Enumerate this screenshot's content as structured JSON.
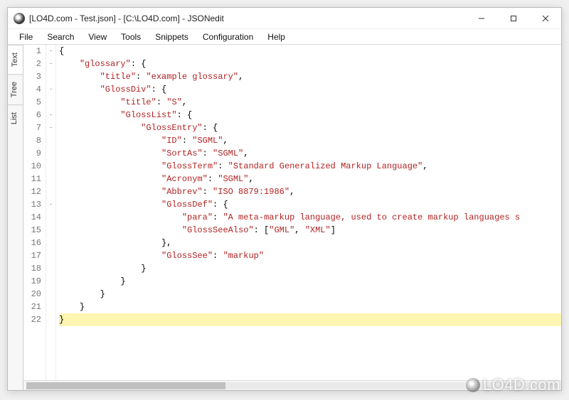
{
  "window": {
    "title": "[LO4D.com - Test.json] - [C:\\LO4D.com] - JSONedit"
  },
  "menu": {
    "file": "File",
    "search": "Search",
    "view": "View",
    "tools": "Tools",
    "snippets": "Snippets",
    "configuration": "Configuration",
    "help": "Help"
  },
  "side_tabs": {
    "text": "Text",
    "tree": "Tree",
    "list": "List"
  },
  "editor": {
    "line_count": 22,
    "fold_markers": {
      "1": "-",
      "2": "-",
      "4": "-",
      "6": "-",
      "7": "-",
      "13": "-"
    },
    "current_line": 22,
    "lines": [
      {
        "n": 1,
        "indent": 0,
        "tokens": [
          {
            "t": "{",
            "c": "p"
          }
        ]
      },
      {
        "n": 2,
        "indent": 4,
        "tokens": [
          {
            "t": "\"glossary\"",
            "c": "k"
          },
          {
            "t": ": {",
            "c": "p"
          }
        ]
      },
      {
        "n": 3,
        "indent": 8,
        "tokens": [
          {
            "t": "\"title\"",
            "c": "k"
          },
          {
            "t": ": ",
            "c": "p"
          },
          {
            "t": "\"example glossary\"",
            "c": "s"
          },
          {
            "t": ",",
            "c": "p"
          }
        ]
      },
      {
        "n": 4,
        "indent": 8,
        "tokens": [
          {
            "t": "\"GlossDiv\"",
            "c": "k"
          },
          {
            "t": ": {",
            "c": "p"
          }
        ]
      },
      {
        "n": 5,
        "indent": 12,
        "tokens": [
          {
            "t": "\"title\"",
            "c": "k"
          },
          {
            "t": ": ",
            "c": "p"
          },
          {
            "t": "\"S\"",
            "c": "s"
          },
          {
            "t": ",",
            "c": "p"
          }
        ]
      },
      {
        "n": 6,
        "indent": 12,
        "tokens": [
          {
            "t": "\"GlossList\"",
            "c": "k"
          },
          {
            "t": ": {",
            "c": "p"
          }
        ]
      },
      {
        "n": 7,
        "indent": 16,
        "tokens": [
          {
            "t": "\"GlossEntry\"",
            "c": "k"
          },
          {
            "t": ": {",
            "c": "p"
          }
        ]
      },
      {
        "n": 8,
        "indent": 20,
        "tokens": [
          {
            "t": "\"ID\"",
            "c": "k"
          },
          {
            "t": ": ",
            "c": "p"
          },
          {
            "t": "\"SGML\"",
            "c": "s"
          },
          {
            "t": ",",
            "c": "p"
          }
        ]
      },
      {
        "n": 9,
        "indent": 20,
        "tokens": [
          {
            "t": "\"SortAs\"",
            "c": "k"
          },
          {
            "t": ": ",
            "c": "p"
          },
          {
            "t": "\"SGML\"",
            "c": "s"
          },
          {
            "t": ",",
            "c": "p"
          }
        ]
      },
      {
        "n": 10,
        "indent": 20,
        "tokens": [
          {
            "t": "\"GlossTerm\"",
            "c": "k"
          },
          {
            "t": ": ",
            "c": "p"
          },
          {
            "t": "\"Standard Generalized Markup Language\"",
            "c": "s"
          },
          {
            "t": ",",
            "c": "p"
          }
        ]
      },
      {
        "n": 11,
        "indent": 20,
        "tokens": [
          {
            "t": "\"Acronym\"",
            "c": "k"
          },
          {
            "t": ": ",
            "c": "p"
          },
          {
            "t": "\"SGML\"",
            "c": "s"
          },
          {
            "t": ",",
            "c": "p"
          }
        ]
      },
      {
        "n": 12,
        "indent": 20,
        "tokens": [
          {
            "t": "\"Abbrev\"",
            "c": "k"
          },
          {
            "t": ": ",
            "c": "p"
          },
          {
            "t": "\"ISO 8879:1986\"",
            "c": "s"
          },
          {
            "t": ",",
            "c": "p"
          }
        ]
      },
      {
        "n": 13,
        "indent": 20,
        "tokens": [
          {
            "t": "\"GlossDef\"",
            "c": "k"
          },
          {
            "t": ": {",
            "c": "p"
          }
        ]
      },
      {
        "n": 14,
        "indent": 24,
        "tokens": [
          {
            "t": "\"para\"",
            "c": "k"
          },
          {
            "t": ": ",
            "c": "p"
          },
          {
            "t": "\"A meta-markup language, used to create markup languages s",
            "c": "s"
          }
        ]
      },
      {
        "n": 15,
        "indent": 24,
        "tokens": [
          {
            "t": "\"GlossSeeAlso\"",
            "c": "k"
          },
          {
            "t": ": [",
            "c": "p"
          },
          {
            "t": "\"GML\"",
            "c": "s"
          },
          {
            "t": ", ",
            "c": "p"
          },
          {
            "t": "\"XML\"",
            "c": "s"
          },
          {
            "t": "]",
            "c": "p"
          }
        ]
      },
      {
        "n": 16,
        "indent": 20,
        "tokens": [
          {
            "t": "},",
            "c": "p"
          }
        ]
      },
      {
        "n": 17,
        "indent": 20,
        "tokens": [
          {
            "t": "\"GlossSee\"",
            "c": "k"
          },
          {
            "t": ": ",
            "c": "p"
          },
          {
            "t": "\"markup\"",
            "c": "s"
          }
        ]
      },
      {
        "n": 18,
        "indent": 16,
        "tokens": [
          {
            "t": "}",
            "c": "p"
          }
        ]
      },
      {
        "n": 19,
        "indent": 12,
        "tokens": [
          {
            "t": "}",
            "c": "p"
          }
        ]
      },
      {
        "n": 20,
        "indent": 8,
        "tokens": [
          {
            "t": "}",
            "c": "p"
          }
        ]
      },
      {
        "n": 21,
        "indent": 4,
        "tokens": [
          {
            "t": "}",
            "c": "p"
          }
        ]
      },
      {
        "n": 22,
        "indent": 0,
        "tokens": [
          {
            "t": "}",
            "c": "p"
          }
        ]
      }
    ]
  },
  "watermark": "LO4D.com"
}
